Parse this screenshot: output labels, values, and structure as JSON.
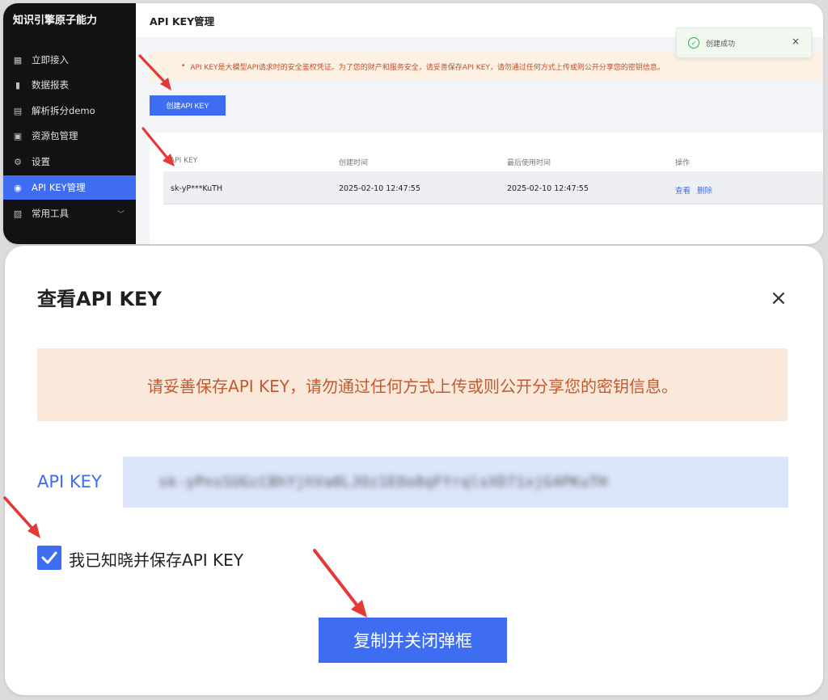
{
  "colors": {
    "accent": "#3f6df2",
    "sidebar_bg": "#121212",
    "warning_bg": "#fdf1e4",
    "warning_text": "#c0502b",
    "arrow": "#e53935"
  },
  "sidebar": {
    "brand": "知识引擎原子能力",
    "items": [
      {
        "label": "立即接入",
        "icon": "grid-icon"
      },
      {
        "label": "数据报表",
        "icon": "bar-chart-icon"
      },
      {
        "label": "解析拆分demo",
        "icon": "document-icon"
      },
      {
        "label": "资源包管理",
        "icon": "package-icon"
      },
      {
        "label": "设置",
        "icon": "gear-icon"
      },
      {
        "label": "API KEY管理",
        "icon": "key-icon",
        "active": true
      },
      {
        "label": "常用工具",
        "icon": "toolbox-icon",
        "expandable": true
      }
    ]
  },
  "page": {
    "title": "API KEY管理",
    "notice": "API KEY是大模型API请求时的安全鉴权凭证。为了您的财产和服务安全，请妥善保存API KEY，请勿通过任何方式上传或则公开分享您的密钥信息。",
    "create_button": "创建API KEY",
    "toast": "创建成功",
    "toast_close": "×"
  },
  "table": {
    "columns": [
      "API KEY",
      "创建时间",
      "最后使用时间",
      "操作"
    ],
    "rows": [
      {
        "key": "sk-yP***KuTH",
        "created": "2025-02-10 12:47:55",
        "last_used": "2025-02-10 12:47:55",
        "actions": [
          "查看",
          "删除"
        ]
      }
    ]
  },
  "modal": {
    "title": "查看API KEY",
    "close": "×",
    "warning": "请妥善保存API KEY，请勿通过任何方式上传或则公开分享您的密钥信息。",
    "key_label": "API KEY",
    "key_value": "sk-yPnsSUGcCBhYjhVa0LJOz1EOo8qFYrqlsXD71xjG4PKuTH",
    "checkbox_label": "我已知晓并保存API KEY",
    "checkbox_checked": true,
    "copy_button": "复制并关闭弹框"
  }
}
